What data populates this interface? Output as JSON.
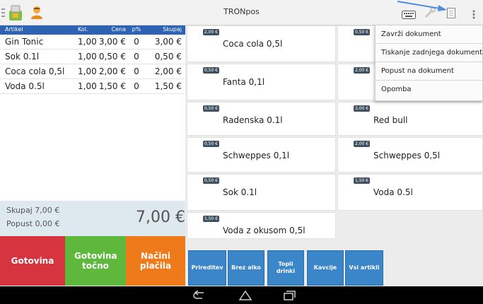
{
  "app": {
    "title": "TRONpos"
  },
  "colors": {
    "table_header": "#2e63b4",
    "cash": "#d6343f",
    "exact": "#5db83b",
    "methods": "#ef7a1a",
    "category": "#3b86c9",
    "price_tag": "#3f5060"
  },
  "icons": [
    "menu-grip-icon",
    "app-logo-icon",
    "user-icon",
    "keyboard-icon",
    "tools-icon",
    "document-icon",
    "overflow-menu-icon",
    "back-icon",
    "home-icon",
    "recents-icon"
  ],
  "order": {
    "columns": {
      "item": "Artikel",
      "qty": "Kol.",
      "price": "Cena",
      "discount": "p%",
      "total": "Skupaj"
    },
    "rows": [
      {
        "name": "Gin Tonic",
        "qty": "1,00",
        "price": "3,00 €",
        "discount": "0",
        "total": "3,00 €"
      },
      {
        "name": "Sok 0.1l",
        "qty": "1,00",
        "price": "0,50 €",
        "discount": "0",
        "total": "0,50 €"
      },
      {
        "name": "Coca cola 0,5l",
        "qty": "1,00",
        "price": "2,00 €",
        "discount": "0",
        "total": "2,00 €"
      },
      {
        "name": "Voda 0.5l",
        "qty": "1,00",
        "price": "1,50 €",
        "discount": "0",
        "total": "1,50 €"
      }
    ]
  },
  "summary": {
    "total_label": "Skupaj 7,00 €",
    "discount_label": "Popust 0,00 €",
    "grand_total": "7,00 €"
  },
  "payment": {
    "cash": "Gotovina",
    "exact": "Gotovina točno",
    "methods": "Načini plačila"
  },
  "products": [
    {
      "price": "2,00 €",
      "name": "Coca cola 0,5l"
    },
    {
      "price": "0,50 €",
      "name": ""
    },
    {
      "price": "0,50 €",
      "name": "Fanta 0,1l"
    },
    {
      "price": "2,00 €",
      "name": ""
    },
    {
      "price": "0,50 €",
      "name": "Radenska 0.1l"
    },
    {
      "price": "3,00 €",
      "name": "Red bull"
    },
    {
      "price": "0,50 €",
      "name": "Schweppes 0,1l"
    },
    {
      "price": "2,00 €",
      "name": "Schweppes 0,5l"
    },
    {
      "price": "0,50 €",
      "name": "Sok 0.1l"
    },
    {
      "price": "1,50 €",
      "name": "Voda 0.5l"
    },
    {
      "price": "1,50 €",
      "name": "Voda z okusom 0,5l"
    }
  ],
  "menu": {
    "items": [
      "Zavrži dokument",
      "Tiskanje zadnjega dokumenta",
      "Popust na dokument",
      "Opomba"
    ]
  },
  "categories": [
    "Prireditev",
    "Brez alko",
    "Topli drinki",
    "Kavcije",
    "Vsi artikli"
  ]
}
